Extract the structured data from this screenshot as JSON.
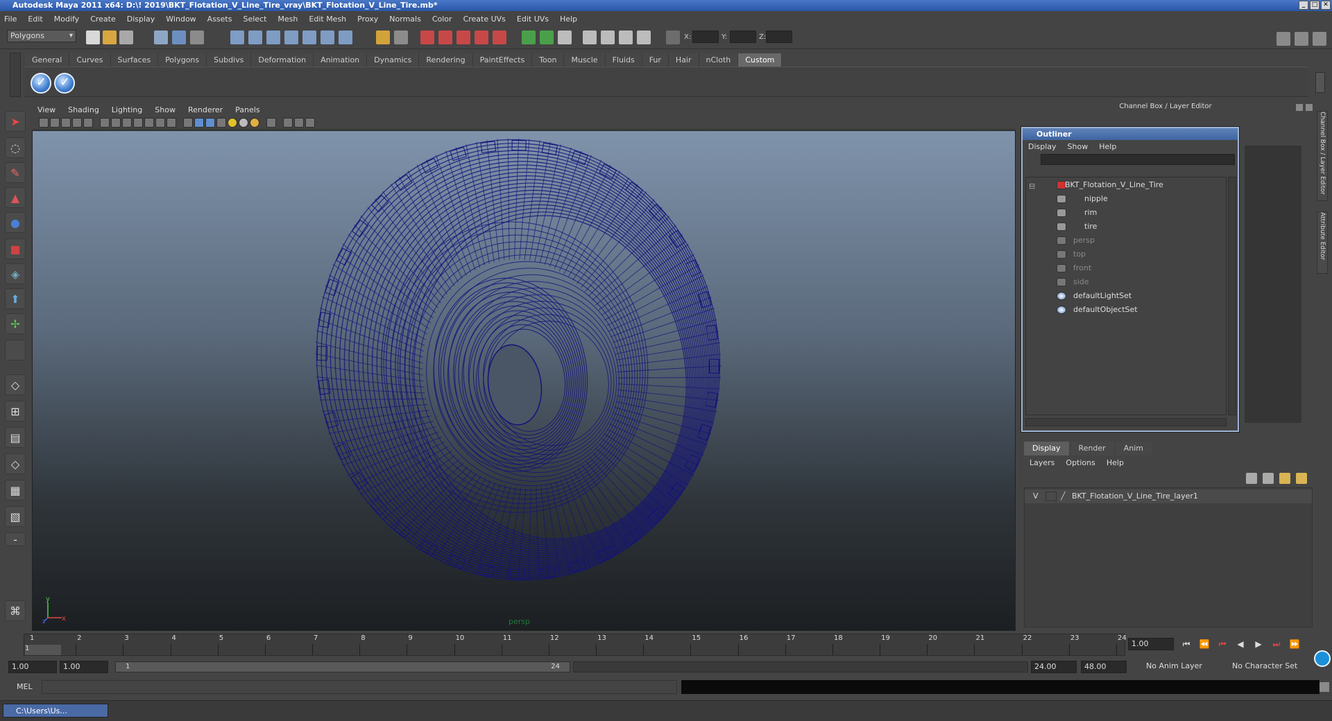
{
  "window": {
    "title": "Autodesk Maya 2011 x64: D:\\! 2019\\BKT_Flotation_V_Line_Tire_vray\\BKT_Flotation_V_Line_Tire.mb*"
  },
  "menubar": [
    "File",
    "Edit",
    "Modify",
    "Create",
    "Display",
    "Window",
    "Assets",
    "Select",
    "Mesh",
    "Edit Mesh",
    "Proxy",
    "Normals",
    "Color",
    "Create UVs",
    "Edit UVs",
    "Help"
  ],
  "toolbar": {
    "mode": "Polygons",
    "x_label": "X:",
    "y_label": "Y:",
    "z_label": "Z:"
  },
  "shelf": {
    "tabs": [
      "General",
      "Curves",
      "Surfaces",
      "Polygons",
      "Subdivs",
      "Deformation",
      "Animation",
      "Dynamics",
      "Rendering",
      "PaintEffects",
      "Toon",
      "Muscle",
      "Fluids",
      "Fur",
      "Hair",
      "nCloth",
      "Custom"
    ],
    "active": "Custom"
  },
  "viewport": {
    "menu": [
      "View",
      "Shading",
      "Lighting",
      "Show",
      "Renderer",
      "Panels"
    ],
    "camera": "persp",
    "axis_y": "y",
    "axis_x": "x",
    "axis_z": "z",
    "wire_color": "#14137a"
  },
  "channel_box": {
    "title": "Channel Box / Layer Editor",
    "side_tab1": "Channel Box / Layer Editor",
    "side_tab2": "Attribute Editor"
  },
  "outliner": {
    "title": "Outliner",
    "menu": [
      "Display",
      "Show",
      "Help"
    ],
    "items": [
      {
        "label": "BKT_Flotation_V_Line_Tire",
        "dim": false
      },
      {
        "label": "nipple",
        "dim": false
      },
      {
        "label": "rim",
        "dim": false
      },
      {
        "label": "tire",
        "dim": false
      },
      {
        "label": "persp",
        "dim": true
      },
      {
        "label": "top",
        "dim": true
      },
      {
        "label": "front",
        "dim": true
      },
      {
        "label": "side",
        "dim": true
      },
      {
        "label": "defaultLightSet",
        "dim": false
      },
      {
        "label": "defaultObjectSet",
        "dim": false
      }
    ]
  },
  "layers": {
    "tabs": [
      "Display",
      "Render",
      "Anim"
    ],
    "active": "Display",
    "menu": [
      "Layers",
      "Options",
      "Help"
    ],
    "visible_flag": "V",
    "layer_name": "BKT_Flotation_V_Line_Tire_layer1"
  },
  "timeline": {
    "ticks": [
      "1",
      "2",
      "3",
      "4",
      "5",
      "6",
      "7",
      "8",
      "9",
      "10",
      "11",
      "12",
      "13",
      "14",
      "15",
      "16",
      "17",
      "18",
      "19",
      "20",
      "21",
      "22",
      "23",
      "24"
    ],
    "current_frame": "1",
    "current_time": "1.00"
  },
  "range": {
    "start": "1.00",
    "inner_start": "1.00",
    "slider_start": "1",
    "slider_end": "24",
    "end": "24.00",
    "outer_end": "48.00",
    "anim_layer": "No Anim Layer",
    "char_set": "No Character Set"
  },
  "cmdline": {
    "label": "MEL"
  },
  "taskbar": {
    "item": "C:\\Users\\Us..."
  }
}
